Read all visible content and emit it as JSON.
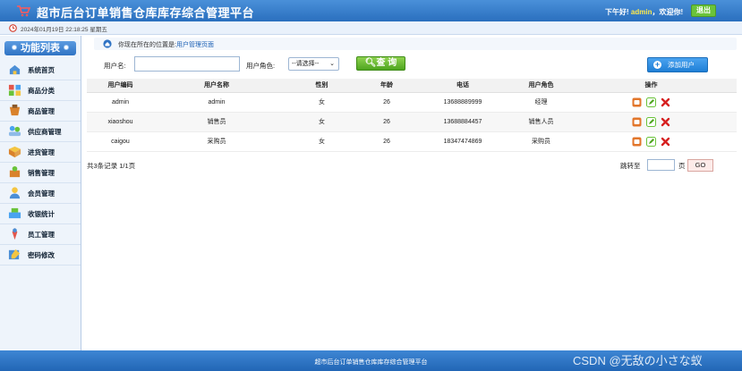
{
  "header": {
    "title": "超市后台订单销售仓库库存综合管理平台",
    "greeting_prefix": "下午好!",
    "username": "admin",
    "greeting_suffix": "，欢迎你!",
    "logout_label": "退出"
  },
  "subbar": {
    "datetime": "2024年01月19日 22:18:25 星期五"
  },
  "sidebar": {
    "title": "功能列表",
    "items": [
      {
        "label": "系统首页",
        "icon": "home-icon"
      },
      {
        "label": "商品分类",
        "icon": "category-icon"
      },
      {
        "label": "商品管理",
        "icon": "goods-icon"
      },
      {
        "label": "供应商管理",
        "icon": "supplier-icon"
      },
      {
        "label": "进货管理",
        "icon": "purchase-icon"
      },
      {
        "label": "销售管理",
        "icon": "sales-icon"
      },
      {
        "label": "会员管理",
        "icon": "member-icon"
      },
      {
        "label": "收银统计",
        "icon": "cashier-icon"
      },
      {
        "label": "员工管理",
        "icon": "staff-icon"
      },
      {
        "label": "密码修改",
        "icon": "password-icon"
      }
    ]
  },
  "location": {
    "prefix": "你现在所在的位置是:",
    "current": "用户管理页面"
  },
  "search": {
    "username_label": "用户名:",
    "username_value": "",
    "role_label": "用户角色:",
    "role_selected": "--请选择--",
    "query_label": "查 询",
    "add_label": "添加用户"
  },
  "table": {
    "headers": [
      "用户编码",
      "用户名称",
      "性别",
      "年龄",
      "电话",
      "用户角色",
      "操作"
    ],
    "rows": [
      [
        "admin",
        "admin",
        "女",
        "26",
        "13688889999",
        "经理"
      ],
      [
        "xiaoshou",
        "销售员",
        "女",
        "26",
        "13688884457",
        "销售人员"
      ],
      [
        "caigou",
        "采购员",
        "女",
        "26",
        "18347474869",
        "采购员"
      ]
    ]
  },
  "pagination": {
    "summary": "共3条记录  1/1页",
    "jump_label": "跳转至",
    "page_unit": "页",
    "go_label": "GO"
  },
  "footer": {
    "text": "超市后台订单销售仓库库存综合管理平台",
    "watermark": "CSDN @无敌の小さな蚁"
  },
  "colors": {
    "header": "#2a6fbe",
    "accent_green": "#4ea51f",
    "accent_blue": "#1f7fd6",
    "delete_red": "#d62020"
  }
}
